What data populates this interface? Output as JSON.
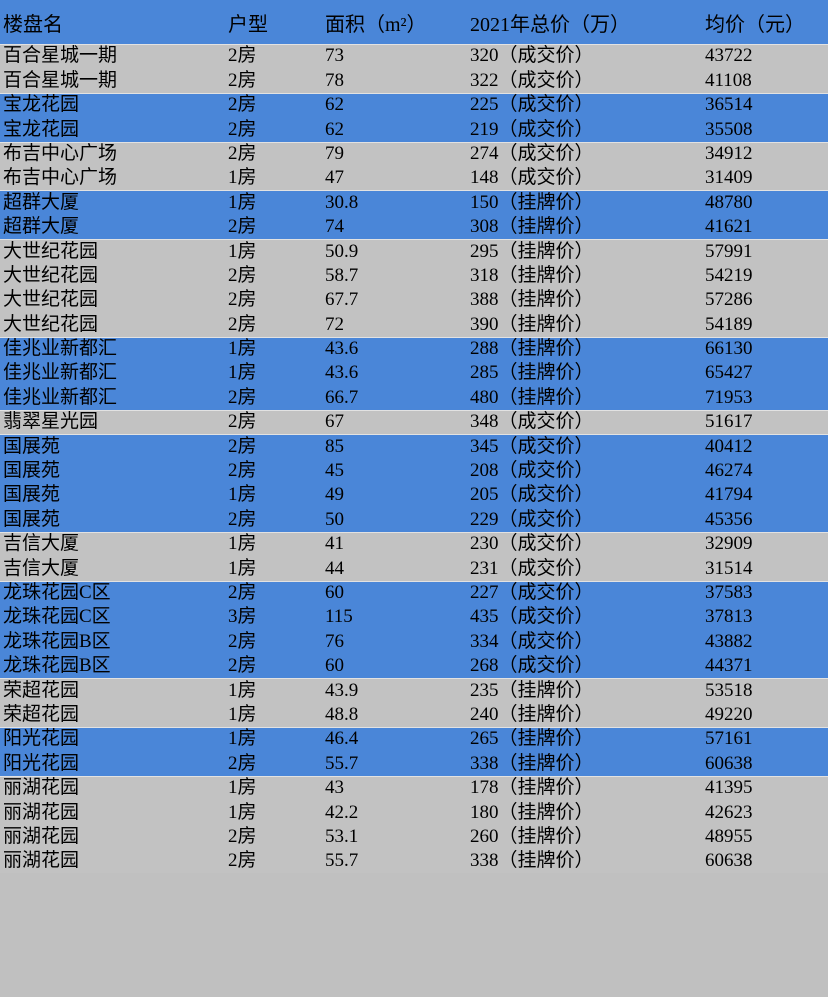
{
  "table": {
    "columns": [
      {
        "key": "name",
        "label": "楼盘名"
      },
      {
        "key": "type",
        "label": "户型"
      },
      {
        "key": "area",
        "label": "面积（m²）"
      },
      {
        "key": "price",
        "label": "2021年总价（万）"
      },
      {
        "key": "unit",
        "label": "均价（元）"
      }
    ],
    "colors": {
      "header_background": "#4a86d8",
      "band_blue": "#4a86d8",
      "band_gray": "#c2c2c2",
      "text": "#000000"
    },
    "rows": [
      {
        "name": "百合星城一期",
        "type": "2房",
        "area": "73",
        "price": "320（成交价）",
        "unit": "43722",
        "band": "gray",
        "group_start": true
      },
      {
        "name": "百合星城一期",
        "type": "2房",
        "area": "78",
        "price": "322（成交价）",
        "unit": "41108",
        "band": "gray",
        "group_start": false
      },
      {
        "name": "宝龙花园",
        "type": "2房",
        "area": "62",
        "price": "225（成交价）",
        "unit": "36514",
        "band": "blue",
        "group_start": true
      },
      {
        "name": "宝龙花园",
        "type": "2房",
        "area": "62",
        "price": "219（成交价）",
        "unit": "35508",
        "band": "blue",
        "group_start": false
      },
      {
        "name": "布吉中心广场",
        "type": "2房",
        "area": "79",
        "price": "274（成交价）",
        "unit": "34912",
        "band": "gray",
        "group_start": true
      },
      {
        "name": "布吉中心广场",
        "type": "1房",
        "area": "47",
        "price": "148（成交价）",
        "unit": "31409",
        "band": "gray",
        "group_start": false
      },
      {
        "name": "超群大厦",
        "type": "1房",
        "area": "30.8",
        "price": "150（挂牌价）",
        "unit": "48780",
        "band": "blue",
        "group_start": true
      },
      {
        "name": "超群大厦",
        "type": "2房",
        "area": "74",
        "price": "308（挂牌价）",
        "unit": "41621",
        "band": "blue",
        "group_start": false
      },
      {
        "name": "大世纪花园",
        "type": "1房",
        "area": "50.9",
        "price": "295（挂牌价）",
        "unit": "57991",
        "band": "gray",
        "group_start": true
      },
      {
        "name": "大世纪花园",
        "type": "2房",
        "area": "58.7",
        "price": "318（挂牌价）",
        "unit": "54219",
        "band": "gray",
        "group_start": false
      },
      {
        "name": "大世纪花园",
        "type": "2房",
        "area": "67.7",
        "price": "388（挂牌价）",
        "unit": "57286",
        "band": "gray",
        "group_start": false
      },
      {
        "name": "大世纪花园",
        "type": "2房",
        "area": "72",
        "price": "390（挂牌价）",
        "unit": "54189",
        "band": "gray",
        "group_start": false
      },
      {
        "name": "佳兆业新都汇",
        "type": "1房",
        "area": "43.6",
        "price": "288（挂牌价）",
        "unit": "66130",
        "band": "blue",
        "group_start": true
      },
      {
        "name": "佳兆业新都汇",
        "type": "1房",
        "area": "43.6",
        "price": "285（挂牌价）",
        "unit": "65427",
        "band": "blue",
        "group_start": false
      },
      {
        "name": "佳兆业新都汇",
        "type": "2房",
        "area": "66.7",
        "price": "480（挂牌价）",
        "unit": "71953",
        "band": "blue",
        "group_start": false
      },
      {
        "name": "翡翠星光园",
        "type": "2房",
        "area": "67",
        "price": "348（成交价）",
        "unit": "51617",
        "band": "gray",
        "group_start": true
      },
      {
        "name": "国展苑",
        "type": "2房",
        "area": "85",
        "price": "345（成交价）",
        "unit": "40412",
        "band": "blue",
        "group_start": true
      },
      {
        "name": "国展苑",
        "type": "2房",
        "area": "45",
        "price": "208（成交价）",
        "unit": "46274",
        "band": "blue",
        "group_start": false
      },
      {
        "name": "国展苑",
        "type": "1房",
        "area": "49",
        "price": "205（成交价）",
        "unit": "41794",
        "band": "blue",
        "group_start": false
      },
      {
        "name": "国展苑",
        "type": "2房",
        "area": "50",
        "price": "229（成交价）",
        "unit": "45356",
        "band": "blue",
        "group_start": false
      },
      {
        "name": "吉信大厦",
        "type": "1房",
        "area": "41",
        "price": "230（成交价）",
        "unit": "32909",
        "band": "gray",
        "group_start": true
      },
      {
        "name": "吉信大厦",
        "type": "1房",
        "area": "44",
        "price": "231（成交价）",
        "unit": "31514",
        "band": "gray",
        "group_start": false
      },
      {
        "name": "龙珠花园C区",
        "type": "2房",
        "area": "60",
        "price": "227（成交价）",
        "unit": "37583",
        "band": "blue",
        "group_start": true
      },
      {
        "name": "龙珠花园C区",
        "type": "3房",
        "area": "115",
        "price": "435（成交价）",
        "unit": "37813",
        "band": "blue",
        "group_start": false
      },
      {
        "name": "龙珠花园B区",
        "type": "2房",
        "area": "76",
        "price": "334（成交价）",
        "unit": "43882",
        "band": "blue",
        "group_start": false
      },
      {
        "name": "龙珠花园B区",
        "type": "2房",
        "area": "60",
        "price": "268（成交价）",
        "unit": "44371",
        "band": "blue",
        "group_start": false
      },
      {
        "name": "荣超花园",
        "type": "1房",
        "area": "43.9",
        "price": "235（挂牌价）",
        "unit": "53518",
        "band": "gray",
        "group_start": true
      },
      {
        "name": "荣超花园",
        "type": "1房",
        "area": "48.8",
        "price": "240（挂牌价）",
        "unit": "49220",
        "band": "gray",
        "group_start": false
      },
      {
        "name": "阳光花园",
        "type": "1房",
        "area": "46.4",
        "price": "265（挂牌价）",
        "unit": "57161",
        "band": "blue",
        "group_start": true
      },
      {
        "name": "阳光花园",
        "type": "2房",
        "area": "55.7",
        "price": "338（挂牌价）",
        "unit": "60638",
        "band": "blue",
        "group_start": false
      },
      {
        "name": "丽湖花园",
        "type": "1房",
        "area": "43",
        "price": "178（挂牌价）",
        "unit": "41395",
        "band": "gray",
        "group_start": true
      },
      {
        "name": "丽湖花园",
        "type": "1房",
        "area": "42.2",
        "price": "180（挂牌价）",
        "unit": "42623",
        "band": "gray",
        "group_start": false
      },
      {
        "name": "丽湖花园",
        "type": "2房",
        "area": "53.1",
        "price": "260（挂牌价）",
        "unit": "48955",
        "band": "gray",
        "group_start": false
      },
      {
        "name": "丽湖花园",
        "type": "2房",
        "area": "55.7",
        "price": "338（挂牌价）",
        "unit": "60638",
        "band": "gray",
        "group_start": false
      }
    ]
  }
}
